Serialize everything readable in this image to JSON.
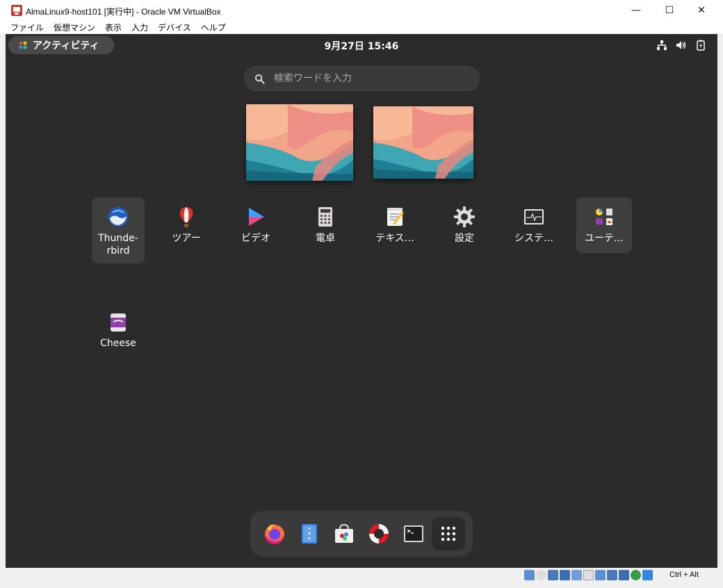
{
  "window": {
    "title": "AlmaLinux9-host101 [実行中] - Oracle VM VirtualBox",
    "minimize": "—",
    "maximize": "☐",
    "close": "✕"
  },
  "menubar": [
    "ファイル",
    "仮想マシン",
    "表示",
    "入力",
    "デバイス",
    "ヘルプ"
  ],
  "topbar": {
    "activities": "アクティビティ",
    "clock": "9月27日  15:46",
    "tray_icons": [
      "network-icon",
      "volume-icon",
      "battery-icon"
    ]
  },
  "search": {
    "placeholder": "検索ワードを入力",
    "value": ""
  },
  "workspaces": [
    {
      "label": "workspace-1"
    },
    {
      "label": "workspace-2"
    }
  ],
  "apps": [
    {
      "label": "Thunde-\nrbird",
      "icon": "thunderbird-icon",
      "highlighted": true
    },
    {
      "label": "ツアー",
      "icon": "tour-balloon-icon"
    },
    {
      "label": "ビデオ",
      "icon": "video-icon"
    },
    {
      "label": "電卓",
      "icon": "calculator-icon"
    },
    {
      "label": "テキス…",
      "icon": "text-editor-icon"
    },
    {
      "label": "設定",
      "icon": "settings-gear-icon"
    },
    {
      "label": "システ…",
      "icon": "system-monitor-icon"
    },
    {
      "label": "ユーテ…",
      "icon": "utilities-folder-icon",
      "highlighted": true
    },
    {
      "label": "Cheese",
      "icon": "cheese-icon"
    }
  ],
  "dock": [
    "firefox-icon",
    "files-icon",
    "software-icon",
    "help-icon",
    "terminal-icon",
    "app-grid-icon"
  ],
  "statusbar": {
    "host_key": "Ctrl + Alt"
  },
  "colors": {
    "guest_bg": "#2b2b2b",
    "panel": "#3a3a3a",
    "accent_blue": "#3584e4"
  }
}
